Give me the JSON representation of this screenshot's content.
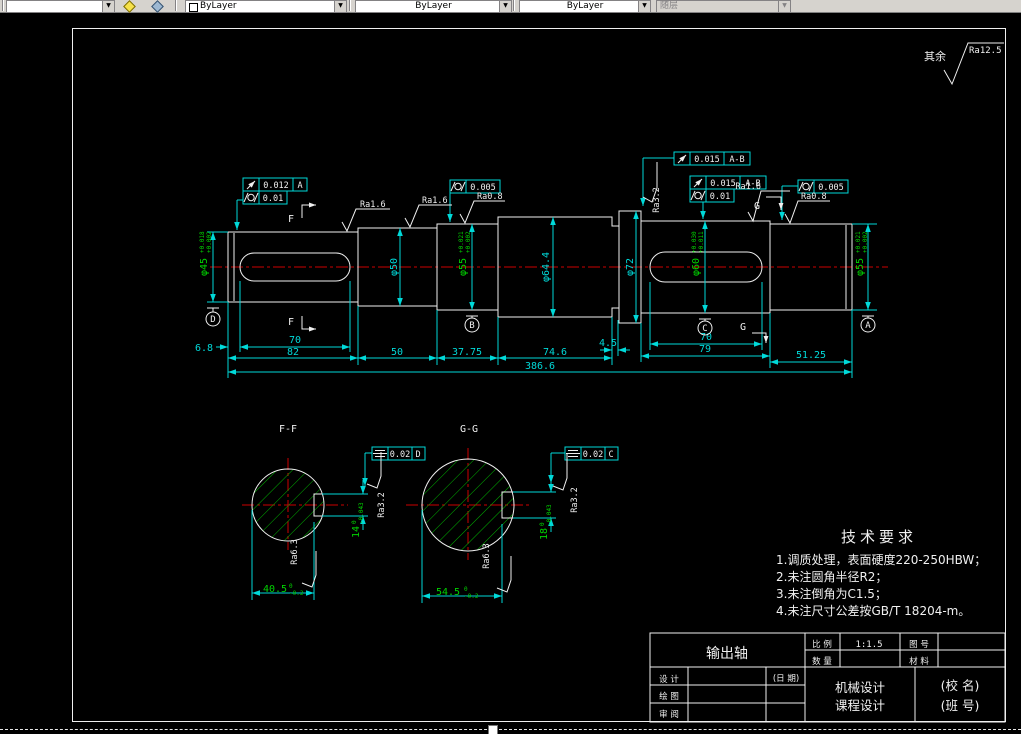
{
  "toolbar": {
    "color_value": "ByLayer",
    "linetype_value": "ByLayer",
    "lineweight_value": "ByLayer",
    "plotstyle_value": "随层"
  },
  "general": {
    "prefix": "其余",
    "value": "Ra12.5"
  },
  "dims": {
    "d45": {
      "v": "φ45",
      "hi": "+0.018",
      "lo": "+0.002"
    },
    "d50": {
      "v": "φ50"
    },
    "d55a": {
      "v": "φ55",
      "hi": "+0.021",
      "lo": "+0.002"
    },
    "d64": {
      "v": "φ64.4"
    },
    "d72": {
      "v": "φ72"
    },
    "d60": {
      "v": "φ60",
      "hi": "+0.030",
      "lo": "+0.011"
    },
    "d55b": {
      "v": "φ55",
      "hi": "+0.021",
      "lo": "+0.002"
    },
    "len_6_8": "6.8",
    "len_70a": "70",
    "len_70b": "70",
    "len_82": "82",
    "len_50": "50",
    "len_37_75": "37.75",
    "len_74_6": "74.6",
    "len_4_5": "4.5",
    "len_79": "79",
    "len_51_25": "51.25",
    "len_total": "386.6"
  },
  "datums": {
    "a": "A",
    "b": "B",
    "c": "C",
    "d": "D"
  },
  "fcf": {
    "f1_val": "0.012",
    "f1_ref": "A",
    "f1b_val": "0.01",
    "f2_val": "0.005",
    "f3_val": "0.015",
    "f3_ref": "A-B",
    "f4_val": "0.015",
    "f4_ref": "A-B",
    "f4b_val": "0.01",
    "f5_val": "0.005",
    "f6_val": "0.02",
    "f6_ref": "D",
    "f7_val": "0.02",
    "f7_ref": "C"
  },
  "rough": {
    "r1": "Ra1.6",
    "r2": "Ra1.6",
    "r3": "Ra0.8",
    "r4": "Ra3.2",
    "r5": "Ra1.6",
    "r6": "Ra0.8"
  },
  "marks": {
    "f": "F",
    "g": "G"
  },
  "ff": {
    "title": "F-F",
    "width_v": "40.5",
    "width_hi": "0",
    "width_lo": "-0.2",
    "key_v": "14",
    "key_hi": "0",
    "key_lo": "-0.043",
    "ra_side": "Ra3.2",
    "ra_bottom": "Ra6.3"
  },
  "gg": {
    "title": "G-G",
    "width_v": "54.5",
    "width_hi": "0",
    "width_lo": "-0.2",
    "key_v": "18",
    "key_hi": "0",
    "key_lo": "-0.043",
    "ra_side": "Ra3.2",
    "ra_bottom": "Ra6.3"
  },
  "tech": {
    "title": "技术要求",
    "line1": "1.调质处理，表面硬度220-250HBW；",
    "line2": "2.未注圆角半径R2；",
    "line3": "3.未注倒角为C1.5；",
    "line4": "4.未注尺寸公差按GB/T 18204-m。"
  },
  "tb": {
    "part": "输出轴",
    "scale_label": "比 例",
    "scale_value": "1:1.5",
    "fig_label": "图 号",
    "qty_label": "数 量",
    "mat_label": "材 料",
    "design_label": "设 计",
    "draw_label": "绘 图",
    "review_label": "审 阅",
    "date_label": "(日 期)",
    "course_line1": "机械设计",
    "course_line2": "课程设计",
    "school": "(校 名)",
    "class": "(班 号)"
  },
  "colors": {
    "dim": "#00d9d9",
    "tol": "#00d400",
    "center": "#cd0000",
    "line": "#f0f0f0"
  }
}
